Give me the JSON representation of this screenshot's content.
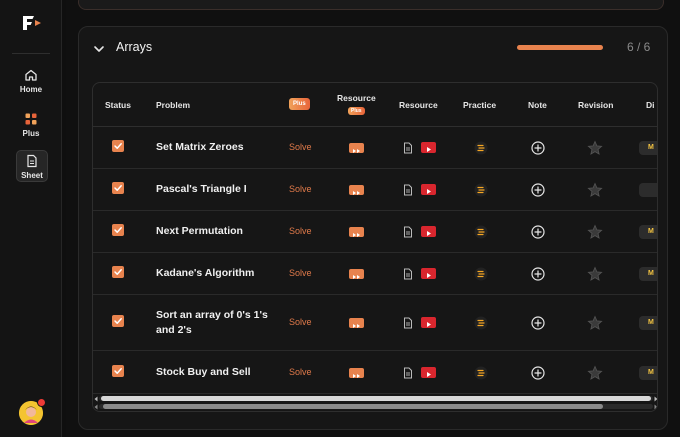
{
  "sidebar": {
    "items": [
      {
        "label": "Home",
        "icon": "home-icon"
      },
      {
        "label": "Plus",
        "icon": "plus-grid-icon"
      },
      {
        "label": "Sheet",
        "icon": "sheet-icon",
        "active": true
      }
    ]
  },
  "section": {
    "title": "Arrays",
    "progress_fraction": 1.0,
    "count": "6 / 6"
  },
  "table": {
    "headers": {
      "status": "Status",
      "problem": "Problem",
      "plus_badge": "Plus",
      "resource_plus": "Resource",
      "resource_plus_badge": "Plus",
      "resource": "Resource",
      "practice": "Practice",
      "note": "Note",
      "revision": "Revision",
      "difficulty": "Di"
    },
    "solve_label": "Solve",
    "rows": [
      {
        "problem": "Set Matrix Zeroes",
        "checked": true,
        "difficulty": "M"
      },
      {
        "problem": "Pascal's Triangle I",
        "checked": true,
        "difficulty": ""
      },
      {
        "problem": "Next Permutation",
        "checked": true,
        "difficulty": "M"
      },
      {
        "problem": "Kadane's Algorithm",
        "checked": true,
        "difficulty": "M"
      },
      {
        "problem": "Sort an array of 0's 1's and 2's",
        "checked": true,
        "difficulty": "M"
      },
      {
        "problem": "Stock Buy and Sell",
        "checked": true,
        "difficulty": "M"
      }
    ]
  },
  "colors": {
    "accent": "#e8834e",
    "youtube": "#d9262e",
    "background": "#0f0f0f"
  }
}
